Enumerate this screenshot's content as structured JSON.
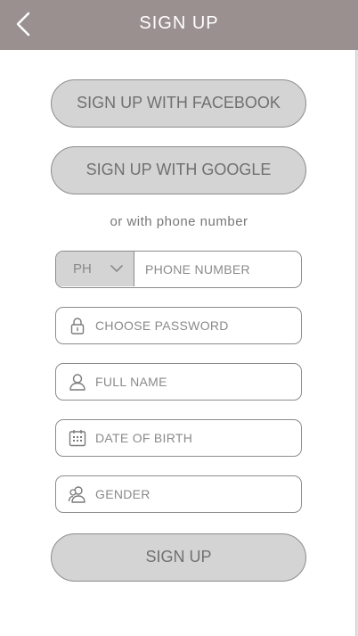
{
  "header": {
    "title": "SIGN UP"
  },
  "social": {
    "facebook_label": "SIGN UP WITH FACEBOOK",
    "google_label": "SIGN UP WITH GOOGLE"
  },
  "alt_text": "or with phone number",
  "phone": {
    "country_code": "PH",
    "placeholder": "PHONE NUMBER"
  },
  "password": {
    "placeholder": "CHOOSE PASSWORD"
  },
  "full_name": {
    "placeholder": "FULL NAME"
  },
  "dob": {
    "placeholder": "DATE OF BIRTH"
  },
  "gender": {
    "placeholder": "GENDER"
  },
  "submit_label": "SIGN UP",
  "icons": {
    "back": "chevron-left-icon",
    "country_dropdown": "chevron-down-icon",
    "password": "lock-icon",
    "full_name": "user-icon",
    "dob": "calendar-icon",
    "gender": "gender-icon"
  },
  "colors": {
    "header_bg": "#9a908f",
    "button_bg": "#d4d4d4",
    "border": "#8c8c8c",
    "text": "#707070"
  }
}
